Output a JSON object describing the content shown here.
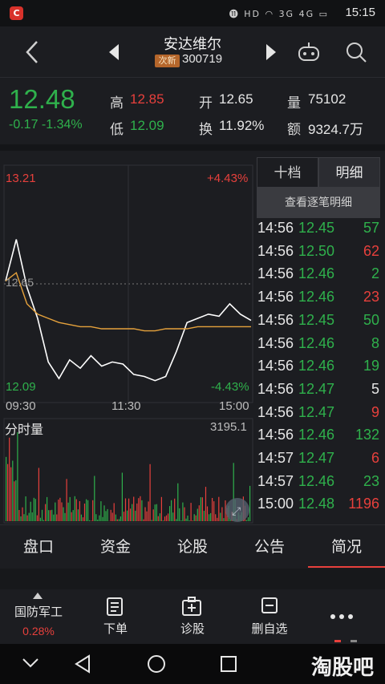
{
  "status_bar": {
    "app_badge": "C",
    "icons": "⓫ HD ◠ 3G 4G ▭",
    "time": "15:15"
  },
  "nav": {
    "stock_name": "安达维尔",
    "badge": "次新",
    "stock_code": "300719"
  },
  "quote": {
    "price": "12.48",
    "change": "-0.17 -1.34%",
    "high_label": "高",
    "high": "12.85",
    "low_label": "低",
    "low": "12.09",
    "open_label": "开",
    "open": "12.65",
    "turnover_label": "换",
    "turnover": "11.92%",
    "volume_label": "量",
    "volume": "75102",
    "amount_label": "额",
    "amount": "9324.7万"
  },
  "chart": {
    "price_top": "13.21",
    "pct_top": "+4.43%",
    "price_bottom": "12.09",
    "pct_bottom": "-4.43%",
    "ref_price": "12.65",
    "time_labels": [
      "09:30",
      "11:30",
      "15:00"
    ],
    "volume_label": "分时量",
    "volume_max": "3195.1"
  },
  "chart_data": {
    "type": "line",
    "title": "",
    "xlabel": "",
    "ylabel": "",
    "ylim": [
      12.09,
      13.21
    ],
    "x": [
      "09:30",
      "11:30",
      "15:00"
    ],
    "series": [
      {
        "values": [
          12.66,
          12.86,
          12.63,
          12.48,
          12.27,
          12.19,
          12.28,
          12.24,
          12.3,
          12.25,
          12.27,
          12.26,
          12.21,
          12.2,
          12.18,
          12.2,
          12.32,
          12.46,
          12.48,
          12.5,
          12.49,
          12.55,
          12.5,
          12.47
        ]
      },
      {
        "values": [
          12.66,
          12.7,
          12.55,
          12.5,
          12.48,
          12.46,
          12.45,
          12.44,
          12.44,
          12.43,
          12.43,
          12.43,
          12.43,
          12.42,
          12.42,
          12.43,
          12.43,
          12.43,
          12.44,
          12.44,
          12.44,
          12.44,
          12.44,
          12.44
        ]
      }
    ],
    "volume": {
      "max": 3195.1
    }
  },
  "ticks": {
    "tab_shidang": "十档",
    "tab_mingxi": "明细",
    "view_detail": "查看逐笔明细",
    "rows": [
      {
        "time": "14:56",
        "price": "12.45",
        "vol": "57",
        "dir": "green"
      },
      {
        "time": "14:56",
        "price": "12.50",
        "vol": "62",
        "dir": "red"
      },
      {
        "time": "14:56",
        "price": "12.46",
        "vol": "2",
        "dir": "green"
      },
      {
        "time": "14:56",
        "price": "12.46",
        "vol": "23",
        "dir": "red"
      },
      {
        "time": "14:56",
        "price": "12.45",
        "vol": "50",
        "dir": "green"
      },
      {
        "time": "14:56",
        "price": "12.46",
        "vol": "8",
        "dir": "green"
      },
      {
        "time": "14:56",
        "price": "12.46",
        "vol": "19",
        "dir": "green"
      },
      {
        "time": "14:56",
        "price": "12.47",
        "vol": "5",
        "dir": "white"
      },
      {
        "time": "14:56",
        "price": "12.47",
        "vol": "9",
        "dir": "red"
      },
      {
        "time": "14:56",
        "price": "12.46",
        "vol": "132",
        "dir": "green"
      },
      {
        "time": "14:57",
        "price": "12.47",
        "vol": "6",
        "dir": "red"
      },
      {
        "time": "14:57",
        "price": "12.46",
        "vol": "23",
        "dir": "green"
      },
      {
        "time": "15:00",
        "price": "12.48",
        "vol": "1196",
        "dir": "red"
      }
    ]
  },
  "tabs": [
    "盘口",
    "资金",
    "论股",
    "公告",
    "简况"
  ],
  "toolbar": {
    "sector_name": "国防军工",
    "sector_pct": "0.28%",
    "order": "下单",
    "diagnose": "诊股",
    "remove_watch": "删自选"
  },
  "watermark": "淘股吧",
  "colors": {
    "up": "#e7403c",
    "down": "#2fb14c",
    "price_line": "#ffffff",
    "avg_line": "#e6a23c",
    "background": "#1c1d21"
  }
}
